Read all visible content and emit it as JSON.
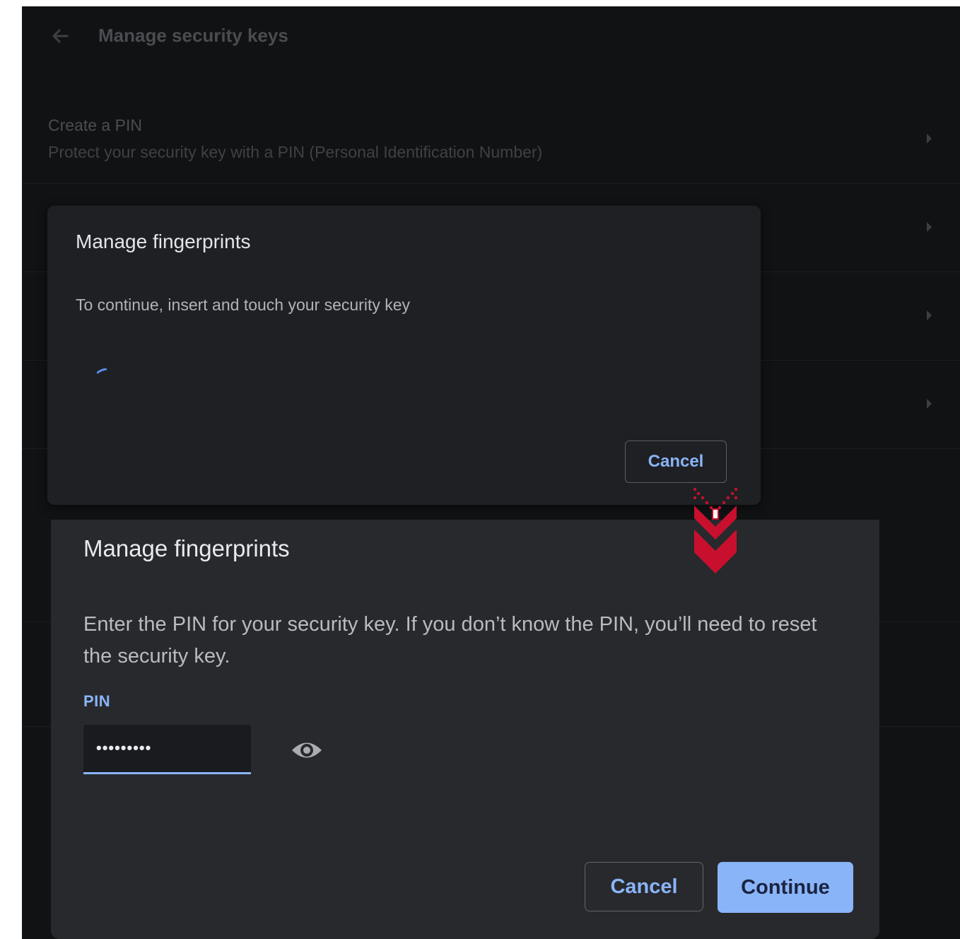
{
  "header": {
    "title": "Manage security keys",
    "back_icon": "arrow-left-icon"
  },
  "rows": [
    {
      "title": "Create a PIN",
      "subtitle": "Protect your security key with a PIN (Personal Identification Number)"
    }
  ],
  "dialog_touch": {
    "title": "Manage fingerprints",
    "body": "To continue, insert and touch your security key",
    "cancel_label": "Cancel"
  },
  "dialog_pin": {
    "title": "Manage fingerprints",
    "body": "Enter the PIN for your security key. If you don’t know the PIN, you’ll need to reset the security key.",
    "pin_label": "PIN",
    "pin_value": "•••••••••",
    "show_pin_icon": "eye-icon",
    "cancel_label": "Cancel",
    "continue_label": "Continue"
  },
  "colors": {
    "background": "#111214",
    "dialog": "#28292d",
    "accent": "#8ab4f8",
    "indicator": "#c8102e"
  }
}
